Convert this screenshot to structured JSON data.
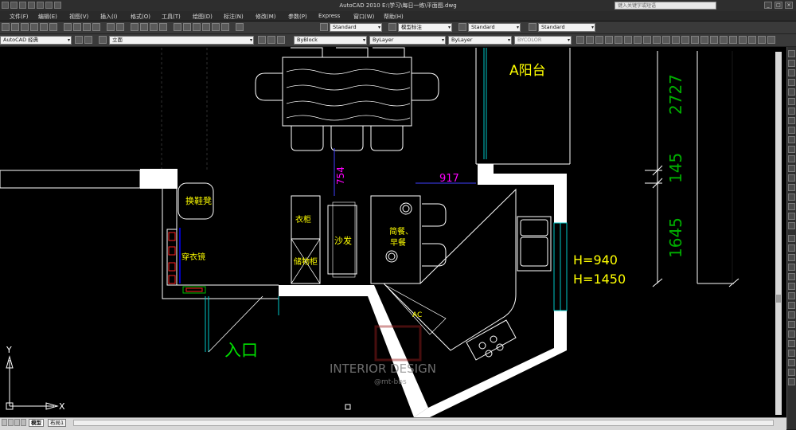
{
  "window": {
    "title": "AutoCAD 2010    E:\\学习\\每日一练\\平面图.dwg",
    "search_placeholder": "键入关键字或短语"
  },
  "menu": [
    "文件(F)",
    "编辑(E)",
    "视图(V)",
    "插入(I)",
    "格式(O)",
    "工具(T)",
    "绘图(D)",
    "标注(N)",
    "修改(M)",
    "参数(P)",
    "Express",
    "窗口(W)",
    "帮助(H)"
  ],
  "toolbar": {
    "text_style": "Standard",
    "dim_style": "模型标注",
    "table_style": "Standard",
    "multileader_style": "Standard",
    "workspace": "AutoCAD 经典",
    "layer": "立面",
    "color": "ByBlock",
    "linetype": "ByLayer",
    "lineweight": "ByLayer",
    "plotstyle": "BYCOLOR"
  },
  "drawing": {
    "room_balcony": "A阳台",
    "shoe_bench": "换鞋凳",
    "wardrobe": "衣柜",
    "storage_cabinet": "储物柜",
    "sofa": "沙发",
    "dining_line1": "简餐、",
    "dining_line2": "早餐",
    "mirror": "穿衣镜",
    "entrance": "入口",
    "ac": "AC",
    "dim_754": "754",
    "dim_917": "917",
    "h1": "H=940",
    "h2": "H=1450",
    "dim_2727": "2727",
    "dim_145": "145",
    "dim_1645": "1645",
    "watermark": "INTERIOR DESIGN",
    "watermark_sub": "@mt-bbs",
    "ucs_x": "X",
    "ucs_y": "Y"
  },
  "tabs": [
    "模型",
    "布局1"
  ],
  "colors": {
    "wall": "#ffffff",
    "label": "#ffff00",
    "dim_magenta": "#ff00ff",
    "dim_green": "#00b000",
    "cyan": "#00c8c8"
  }
}
